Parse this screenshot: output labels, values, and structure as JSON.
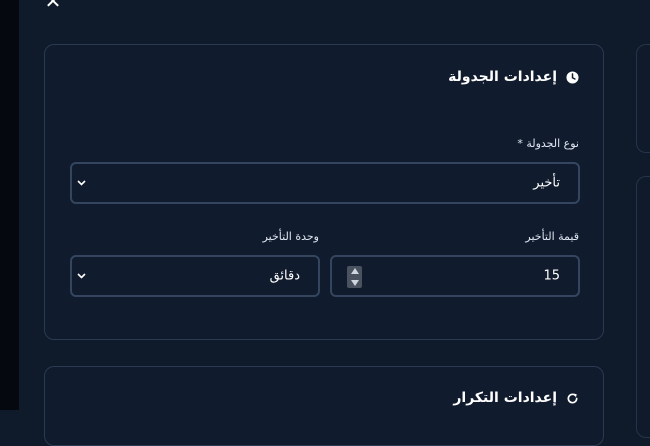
{
  "dialog": {
    "close_icon": "close-icon"
  },
  "schedule_settings": {
    "title": "إعدادات الجدولة",
    "icon": "clock-icon",
    "schedule_type": {
      "label": "نوع الجدولة *",
      "value": "تأخير"
    },
    "delay_value": {
      "label": "قيمة التأخير",
      "value": "15"
    },
    "delay_unit": {
      "label": "وحدة التأخير",
      "value": "دقائق"
    }
  },
  "repeat_settings": {
    "title": "إعدادات التكرار",
    "icon": "refresh-icon"
  },
  "colors": {
    "background": "#0f1a2b",
    "card_border": "#2a3a52",
    "input_border": "#34465f",
    "text": "#ffffff"
  }
}
